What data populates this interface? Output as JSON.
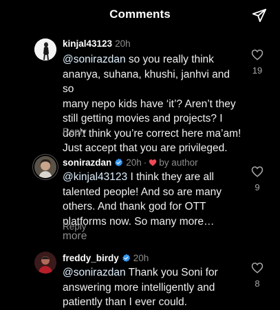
{
  "header": {
    "title": "Comments",
    "send_icon": "paper-plane-icon"
  },
  "comments": [
    {
      "username": "kinjal43123",
      "time": "20h",
      "mention": "@sonirazdan",
      "lines": [
        " so you really think",
        "ananya, suhana, khushi, janhvi and so",
        "many nepo kids have ‘it’? Aren’t they",
        "still getting movies and projects? I",
        "don’t think you’re correct here ma’am!",
        "Just accept that you are privileged."
      ],
      "reply": "Reply",
      "likes": "19"
    },
    {
      "username": "sonirazdan",
      "time": "20h",
      "dot": "·",
      "by_author": "by author",
      "mention": "@kinjal43123",
      "lines": [
        " I think they are all",
        "talented people! And so are many",
        "others. And thank god for OTT",
        "platforms now. So many more… "
      ],
      "more": "more",
      "reply": "Reply",
      "likes": "9"
    },
    {
      "username": "freddy_birdy",
      "time": "20h",
      "mention": "@sonirazdan",
      "lines": [
        " Thank you Soni for",
        "answering more intelligently and",
        "patiently than I ever could."
      ],
      "likes": "8"
    }
  ],
  "colors": {
    "background": "#000000",
    "verified": "#3897f0",
    "heart": "#ed4956",
    "muted": "#8e8e8e"
  }
}
